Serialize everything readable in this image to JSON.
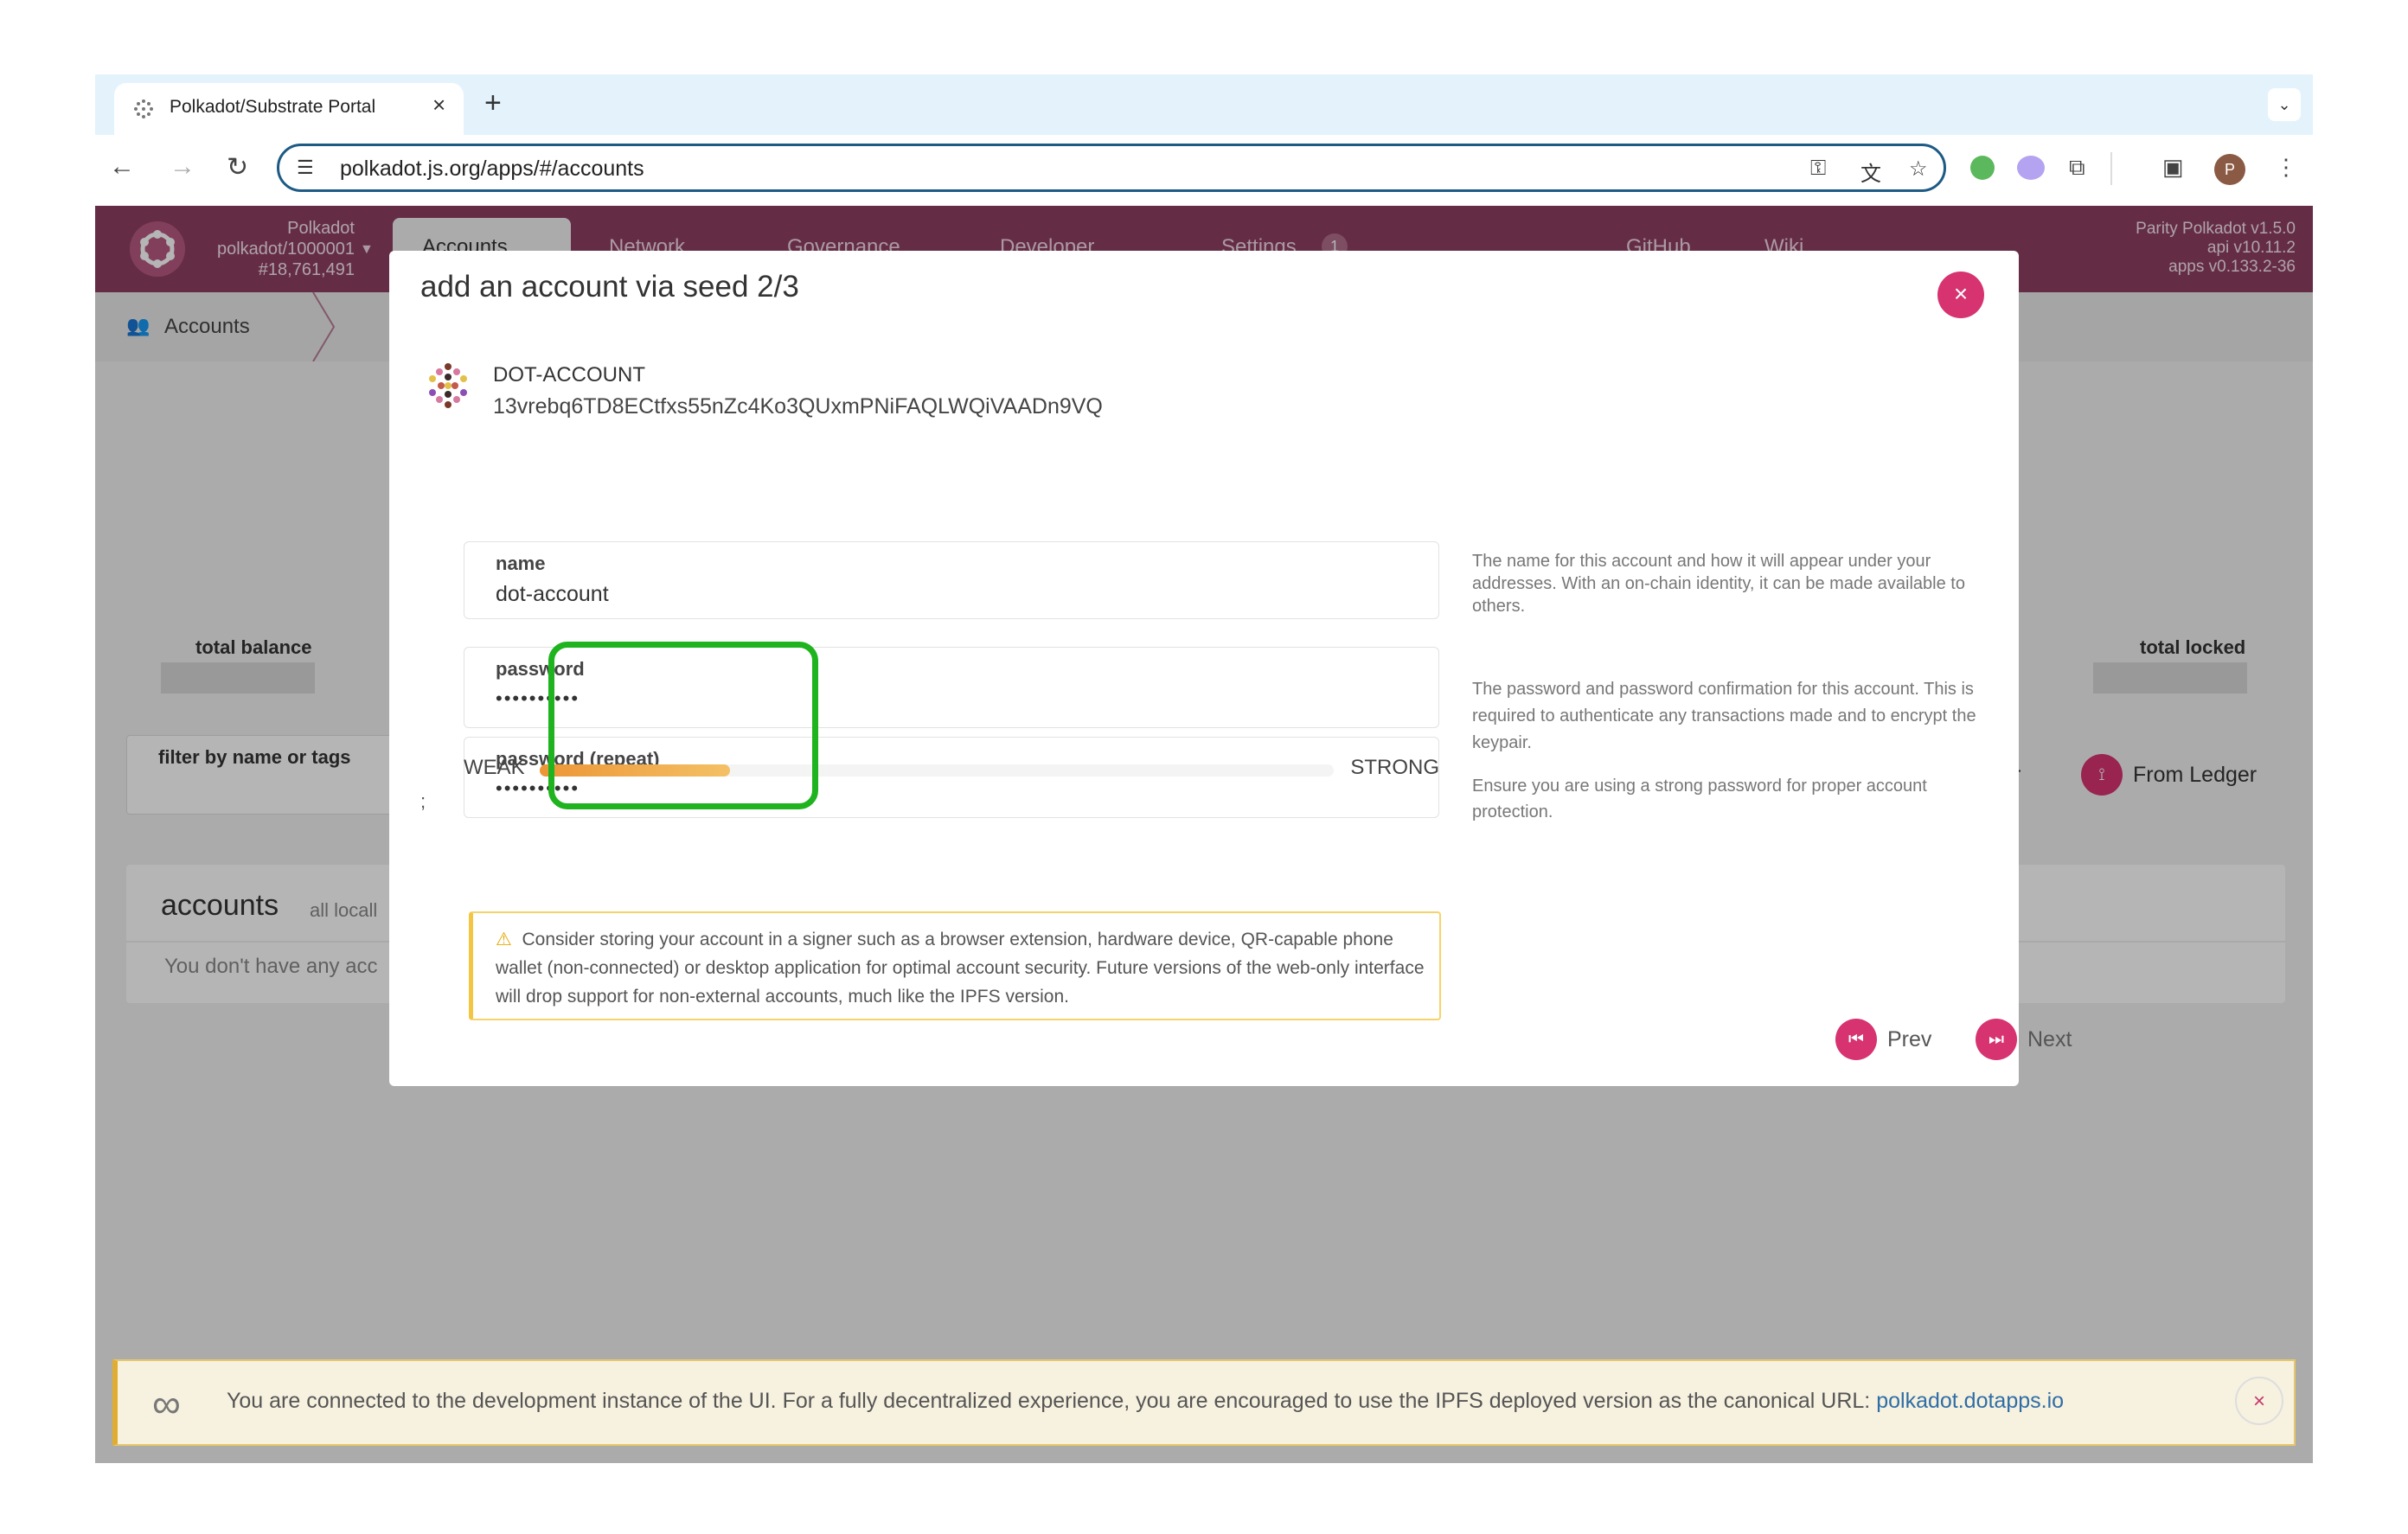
{
  "browser": {
    "tab_title": "Polkadot/Substrate Portal",
    "tab_close": "×",
    "new_tab": "+",
    "tab_menu": "⌄",
    "url": "polkadot.js.org/apps/#/accounts",
    "profile_initial": "P"
  },
  "header": {
    "chain_name": "Polkadot",
    "chain_spec": "polkadot/1000001",
    "block": "#18,761,491",
    "nav": [
      "Accounts",
      "Network",
      "Governance",
      "Developer",
      "Settings",
      "GitHub",
      "Wiki"
    ],
    "settings_badge": "1",
    "versions": [
      "Parity Polkadot v1.5.0",
      "api v10.11.2",
      "apps v0.133.2-36"
    ]
  },
  "subnav": {
    "label": "Accounts"
  },
  "background": {
    "total_balance": "total balance",
    "total_locked": "total locked",
    "filter_label": "filter by name or tags",
    "accounts_heading": "accounts",
    "accounts_sub": "all locall",
    "empty": "You don't have any acc",
    "from_ledger": "From Ledger",
    "qr_fragment": "r"
  },
  "modal": {
    "title": "add an account via seed 2/3",
    "close": "×",
    "account_name": "DOT-ACCOUNT",
    "account_address": "13vrebq6TD8ECtfxs55nZc4Ko3QUxmPNiFAQLWQiVAADn9VQ",
    "name_label": "name",
    "name_value": "dot-account",
    "password_label": "password",
    "password_value": "••••••••••",
    "password_repeat_label": "password (repeat)",
    "password_repeat_value": "••••••••••",
    "help_name": "The name for this account and how it will appear under your addresses. With an on-chain identity, it can be made available to others.",
    "help_password": "The password and password confirmation for this account. This is required to authenticate any transactions made and to encrypt the keypair.",
    "help_strong": "Ensure you are using a strong password for proper account protection.",
    "weak": "WEAK",
    "strong": "STRONG",
    "strength_fraction": 0.24,
    "stray": ";",
    "warning_icon": "⚠",
    "warning": "Consider storing your account in a signer such as a browser extension, hardware device, QR-capable phone wallet (non-connected) or desktop application for optimal account security. Future versions of the web-only interface will drop support for non-external accounts, much like the IPFS version.",
    "prev": "Prev",
    "next": "Next"
  },
  "banner": {
    "text": "You are connected to the development instance of the UI. For a fully decentralized experience, you are encouraged to use the IPFS deployed version as the canonical URL: ",
    "link": "polkadot.dotapps.io",
    "close": "×"
  },
  "colors": {
    "brand": "#8f3e63",
    "accent": "#d63370",
    "highlight": "#1fb31f",
    "warning": "#f4c542"
  },
  "icons": [
    "back-arrow-icon",
    "forward-arrow-icon",
    "reload-icon",
    "site-settings-icon",
    "key-icon",
    "translate-icon",
    "star-icon",
    "extension-icon",
    "sidepanel-icon",
    "more-icon",
    "people-icon",
    "link-icon"
  ]
}
